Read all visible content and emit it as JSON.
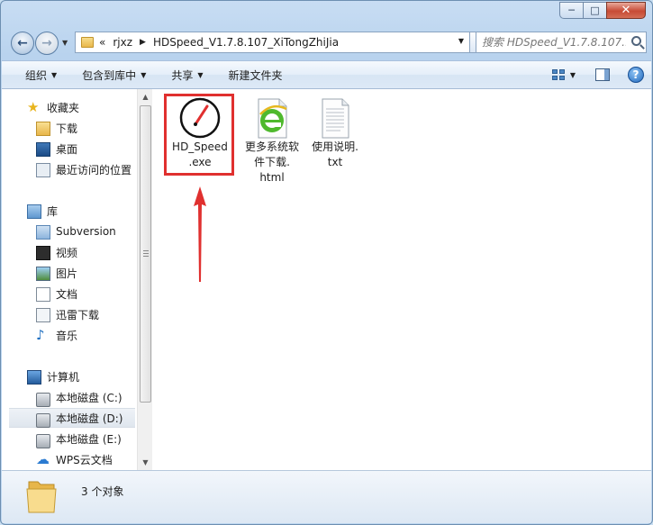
{
  "window": {
    "caption_buttons": {
      "minimize": "─",
      "maximize": "□",
      "close": "✕"
    }
  },
  "nav": {
    "back_icon": "arrow-left-icon",
    "forward_icon": "arrow-right-icon",
    "breadcrumb_prefix": "«",
    "breadcrumbs": [
      "rjxz",
      "HDSpeed_V1.7.8.107_XiTongZhiJia"
    ],
    "crumb_separator": "▶",
    "search_placeholder": "搜索 HDSpeed_V1.7.8.107..."
  },
  "toolbar": {
    "items": [
      {
        "label": "组织",
        "dropdown": true
      },
      {
        "label": "包含到库中",
        "dropdown": true
      },
      {
        "label": "共享",
        "dropdown": true
      },
      {
        "label": "新建文件夹",
        "dropdown": false
      }
    ],
    "dropdown_glyph": "▼",
    "help_label": "?"
  },
  "sidebar": {
    "items": [
      {
        "label": "收藏夹",
        "icon": "star-icon",
        "level": 0
      },
      {
        "label": "下载",
        "icon": "download-folder-icon",
        "level": 1
      },
      {
        "label": "桌面",
        "icon": "desktop-icon",
        "level": 1
      },
      {
        "label": "最近访问的位置",
        "icon": "recent-places-icon",
        "level": 1
      },
      {
        "label": "库",
        "icon": "library-icon",
        "level": 0
      },
      {
        "label": "Subversion",
        "icon": "subversion-library-icon",
        "level": 1
      },
      {
        "label": "视频",
        "icon": "video-icon",
        "level": 1
      },
      {
        "label": "图片",
        "icon": "pictures-icon",
        "level": 1
      },
      {
        "label": "文档",
        "icon": "documents-icon",
        "level": 1
      },
      {
        "label": "迅雷下载",
        "icon": "thunder-download-icon",
        "level": 1
      },
      {
        "label": "音乐",
        "icon": "music-icon",
        "level": 1
      },
      {
        "label": "计算机",
        "icon": "computer-icon",
        "level": 0
      },
      {
        "label": "本地磁盘 (C:)",
        "icon": "system-drive-icon",
        "level": 1
      },
      {
        "label": "本地磁盘 (D:)",
        "icon": "drive-icon",
        "level": 1,
        "selected": true
      },
      {
        "label": "本地磁盘 (E:)",
        "icon": "drive-icon",
        "level": 1
      },
      {
        "label": "WPS云文档",
        "icon": "cloud-icon",
        "level": 1
      }
    ]
  },
  "files": [
    {
      "name": "HD_Speed.exe",
      "line1": "HD_Speed",
      "line2": ".exe",
      "line3": "",
      "icon": "speedometer-app-icon",
      "highlighted": true
    },
    {
      "name": "更多系统软件下载.html",
      "line1": "更多系统软",
      "line2": "件下载.",
      "line3": "html",
      "icon": "ie-html-icon",
      "highlighted": false
    },
    {
      "name": "使用说明.txt",
      "line1": "使用说明.",
      "line2": "txt",
      "line3": "",
      "icon": "text-file-icon",
      "highlighted": false
    }
  ],
  "status": {
    "item_count": "3 个对象"
  },
  "colors": {
    "highlight": "#e0302f",
    "accent": "#1f67bd"
  }
}
